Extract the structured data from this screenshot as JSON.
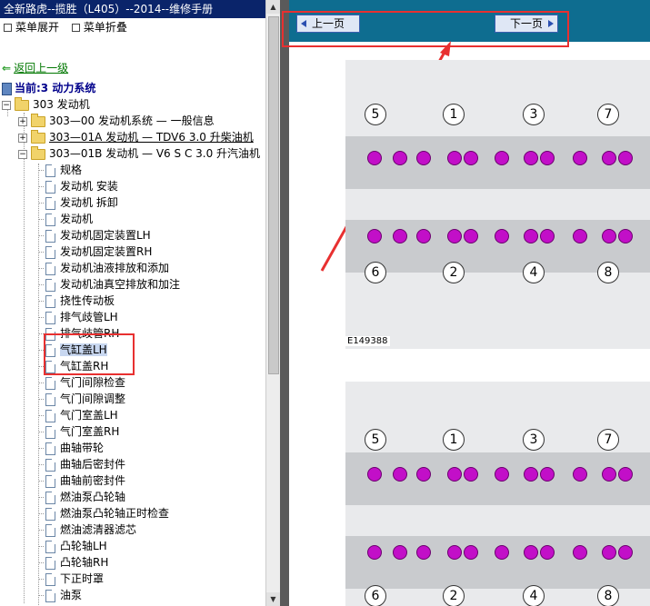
{
  "window_title": "全新路虎--揽胜（L405）--2014--维修手册",
  "menu": {
    "expand": "菜单展开",
    "collapse": "菜单折叠"
  },
  "back_link": "返回上一级",
  "current": "当前:3 动力系统",
  "tree": {
    "root": "303 发动机",
    "folders": [
      "303—00 发动机系统 — 一般信息",
      "303—01A 发动机 — TDV6 3.0 升柴油机",
      "303—01B 发动机 — V6 S C 3.0 升汽油机"
    ],
    "items": [
      "规格",
      "发动机 安装",
      "发动机 拆卸",
      "发动机",
      "发动机固定装置LH",
      "发动机固定装置RH",
      "发动机油液排放和添加",
      "发动机油真空排放和加注",
      "挠性传动板",
      "排气歧管LH",
      "排气歧管RH",
      "气缸盖LH",
      "气缸盖RH",
      "气门间隙检查",
      "气门间隙调整",
      "气门室盖LH",
      "气门室盖RH",
      "曲轴带轮",
      "曲轴后密封件",
      "曲轴前密封件",
      "燃油泵凸轮轴",
      "燃油泵凸轮轴正时检查",
      "燃油滤清器滤芯",
      "凸轮轴LH",
      "凸轮轴RH",
      "下正时罩",
      "油泵"
    ]
  },
  "nav": {
    "prev": "上一页",
    "next": "下一页"
  },
  "diagram": {
    "caption": "E149388",
    "top_numbers": [
      "5",
      "1",
      "3",
      "7"
    ],
    "bottom_numbers": [
      "6",
      "2",
      "4",
      "8"
    ]
  },
  "colors": {
    "title_bar": "#0a246a",
    "toolbar": "#0e6d90",
    "highlight": "#e83030",
    "bolt": "#c20fc8"
  }
}
